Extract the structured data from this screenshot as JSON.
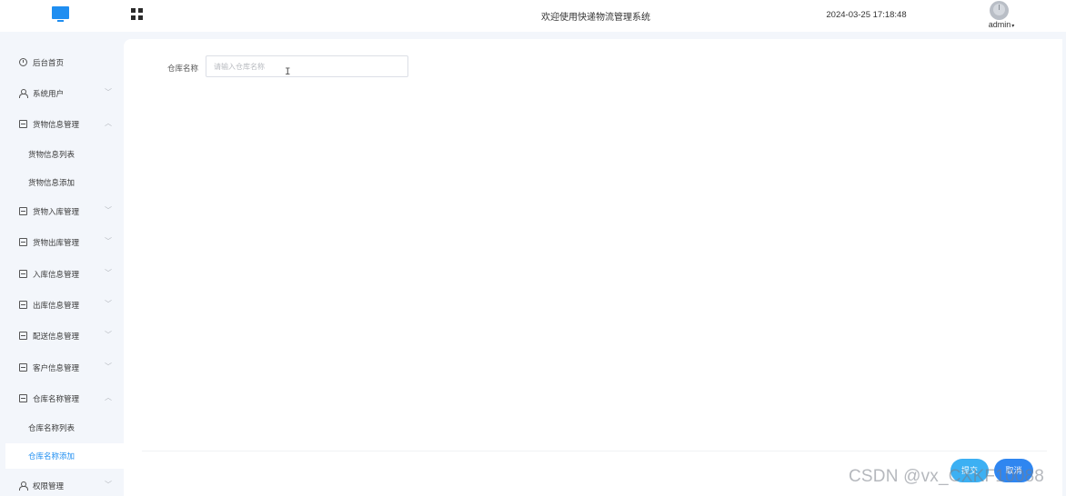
{
  "header": {
    "logo_icon": "monitor-icon",
    "apps_icon": "grid-icon",
    "welcome": "欢迎使用快递物流管理系统",
    "datetime": "2024-03-25 17:18:48",
    "username": "admin",
    "user_caret": "▾"
  },
  "sidebar": {
    "items": [
      {
        "label": "后台首页",
        "icon": "clock-icon",
        "arrow": ""
      },
      {
        "label": "系统用户",
        "icon": "user-icon",
        "arrow": "﹀"
      },
      {
        "label": "货物信息管理",
        "icon": "box-icon",
        "arrow": "︿"
      },
      {
        "label": "货物信息列表"
      },
      {
        "label": "货物信息添加"
      },
      {
        "label": "货物入库管理",
        "icon": "box-icon",
        "arrow": "﹀"
      },
      {
        "label": "货物出库管理",
        "icon": "box-icon",
        "arrow": "﹀"
      },
      {
        "label": "入库信息管理",
        "icon": "box-icon",
        "arrow": "﹀"
      },
      {
        "label": "出库信息管理",
        "icon": "box-icon",
        "arrow": "﹀"
      },
      {
        "label": "配送信息管理",
        "icon": "box-icon",
        "arrow": "﹀"
      },
      {
        "label": "客户信息管理",
        "icon": "box-icon",
        "arrow": "﹀"
      },
      {
        "label": "仓库名称管理",
        "icon": "box-icon",
        "arrow": "︿"
      },
      {
        "label": "仓库名称列表"
      },
      {
        "label": "仓库名称添加"
      },
      {
        "label": "权限管理",
        "icon": "user-icon",
        "arrow": "﹀"
      }
    ]
  },
  "form": {
    "warehouse_label": "仓库名称",
    "warehouse_value": "",
    "warehouse_placeholder": "请输入仓库名称",
    "submit_label": "提交",
    "cancel_label": "取消"
  },
  "watermark": "CSDN @vx_CXKF10088",
  "colors": {
    "accent": "#1f8ef1",
    "submit": "#3cb0f3",
    "cancel": "#2f86f0",
    "sidebar_bg": "#f3f6fb"
  }
}
